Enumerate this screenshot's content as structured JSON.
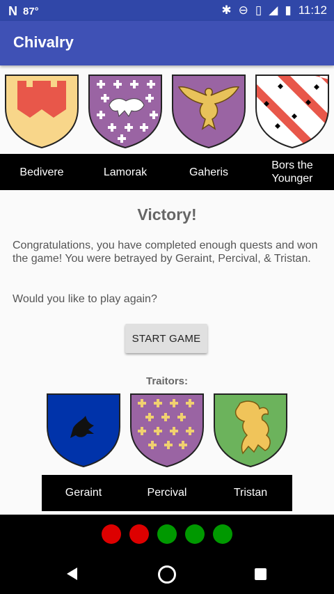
{
  "status_bar": {
    "battery_level": "87°",
    "time": "11:12"
  },
  "app_bar": {
    "title": "Chivalry"
  },
  "knights": [
    {
      "name": "Bedivere",
      "shield_icon": "yellow-shield-red-tower-icon"
    },
    {
      "name": "Lamorak",
      "shield_icon": "purple-shield-lion-crosses-icon"
    },
    {
      "name": "Gaheris",
      "shield_icon": "purple-shield-gold-eagle-icon"
    },
    {
      "name": "Bors the Younger",
      "shield_icon": "white-shield-red-bends-ermine-icon"
    }
  ],
  "result": {
    "heading": "Victory!",
    "message": "Congratulations, you have completed enough quests and won the game! You were betrayed by Geraint, Percival, & Tristan.",
    "prompt": "Would you like to play again?",
    "start_button": "START GAME"
  },
  "traitors": {
    "label": "Traitors:",
    "items": [
      {
        "name": "Geraint",
        "shield_icon": "blue-shield-black-bird-icon"
      },
      {
        "name": "Percival",
        "shield_icon": "purple-shield-gold-crosses-icon"
      },
      {
        "name": "Tristan",
        "shield_icon": "green-shield-gold-lion-icon"
      }
    ]
  },
  "quest_results": [
    "failed",
    "failed",
    "succeeded",
    "succeeded",
    "succeeded"
  ],
  "colors": {
    "failed": "#dd0000",
    "succeeded": "#009900",
    "appbar": "#3f51b5",
    "statusbar": "#3047a8"
  }
}
